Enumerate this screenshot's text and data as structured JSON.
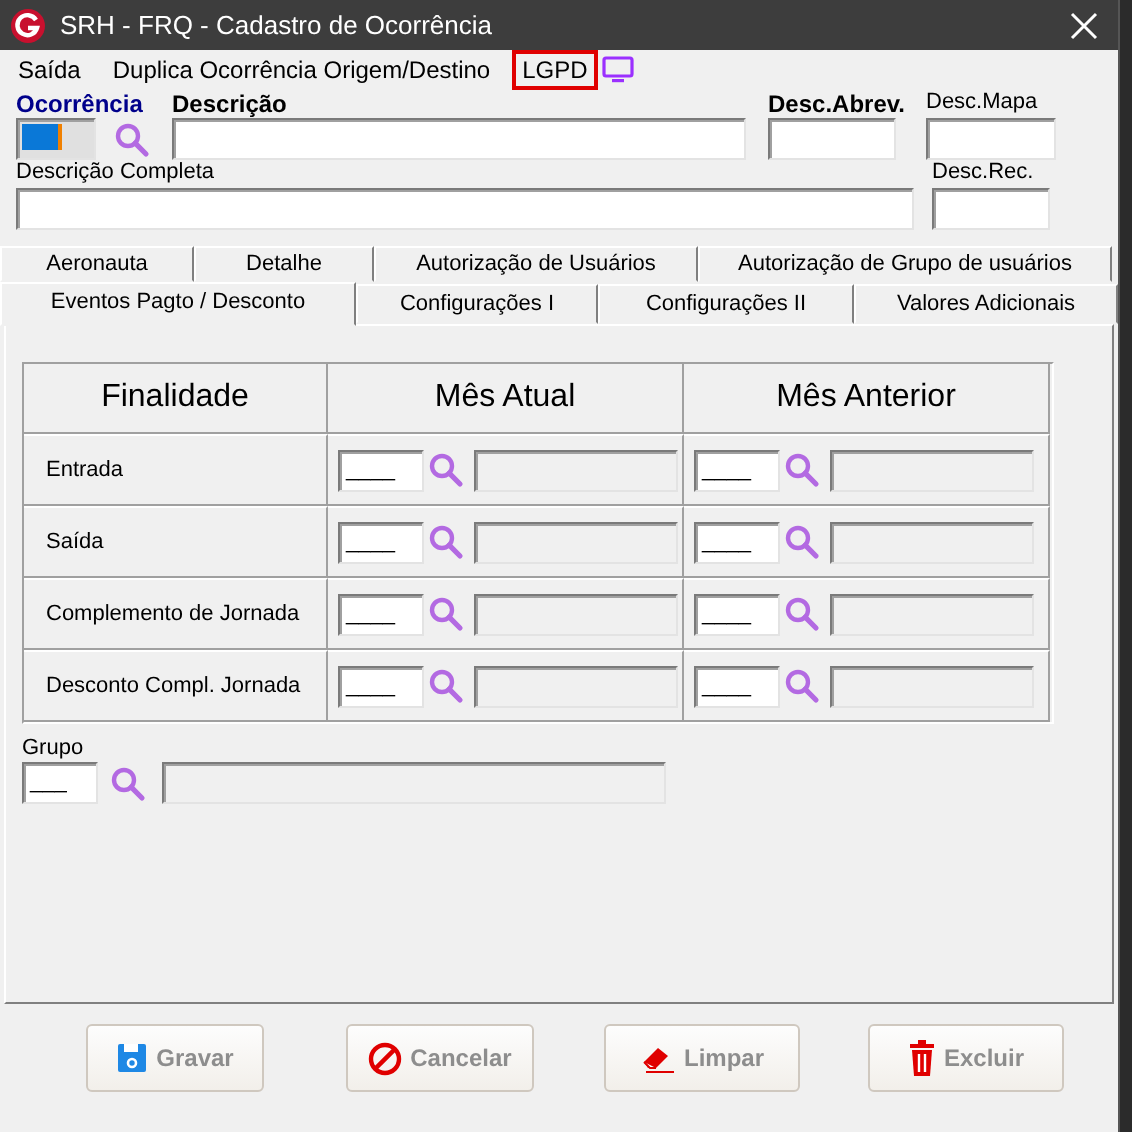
{
  "window": {
    "title": "SRH - FRQ - Cadastro de Ocorrência"
  },
  "menu": [
    {
      "label": "Saída",
      "outlined": false
    },
    {
      "label": "Duplica Ocorrência Origem/Destino",
      "outlined": false
    },
    {
      "label": "LGPD",
      "outlined": true
    }
  ],
  "header_rows": [
    [
      {
        "label": "Ocorrência",
        "kind": "key",
        "focused": true,
        "lookup": true
      },
      {
        "label": "Descrição",
        "kind": "bold",
        "focused": false,
        "lookup": false
      },
      {
        "label": "Desc.Abrev.",
        "kind": "bold",
        "focused": false,
        "lookup": false
      },
      {
        "label": "Desc.Mapa",
        "kind": "plain",
        "focused": false,
        "lookup": false
      }
    ],
    [
      {
        "label": "Descrição Completa",
        "kind": "plain",
        "focused": false,
        "lookup": false
      },
      {
        "label": "Desc.Rec.",
        "kind": "plain",
        "focused": false,
        "lookup": false
      }
    ]
  ],
  "tabs": [
    [
      {
        "label": "Aeronauta",
        "selected": false
      },
      {
        "label": "Detalhe",
        "selected": false
      },
      {
        "label": "Autorização de Usuários",
        "selected": false
      },
      {
        "label": "Autorização de Grupo de usuários",
        "selected": false
      }
    ],
    [
      {
        "label": "Eventos Pagto / Desconto",
        "selected": true
      },
      {
        "label": "Configurações I",
        "selected": false
      },
      {
        "label": "Configurações II",
        "selected": false
      },
      {
        "label": "Valores Adicionais",
        "selected": false
      }
    ]
  ],
  "grid": {
    "columns": [
      "Finalidade",
      "Mês Atual",
      "Mês Anterior"
    ],
    "rows": [
      {
        "label": "Entrada",
        "current": "____",
        "previous": "____"
      },
      {
        "label": "Saída",
        "current": "____",
        "previous": "____"
      },
      {
        "label": "Complemento de Jornada",
        "current": "____",
        "previous": "____"
      },
      {
        "label": "Desconto Compl. Jornada",
        "current": "____",
        "previous": "____"
      }
    ]
  },
  "group": {
    "label": "Grupo",
    "code": "___"
  },
  "buttons": [
    {
      "label": "Gravar",
      "kind": "save",
      "disabled": true
    },
    {
      "label": "Cancelar",
      "kind": "cancel",
      "disabled": true
    },
    {
      "label": "Limpar",
      "kind": "clear",
      "disabled": true
    },
    {
      "label": "Excluir",
      "kind": "delete",
      "disabled": true
    }
  ]
}
